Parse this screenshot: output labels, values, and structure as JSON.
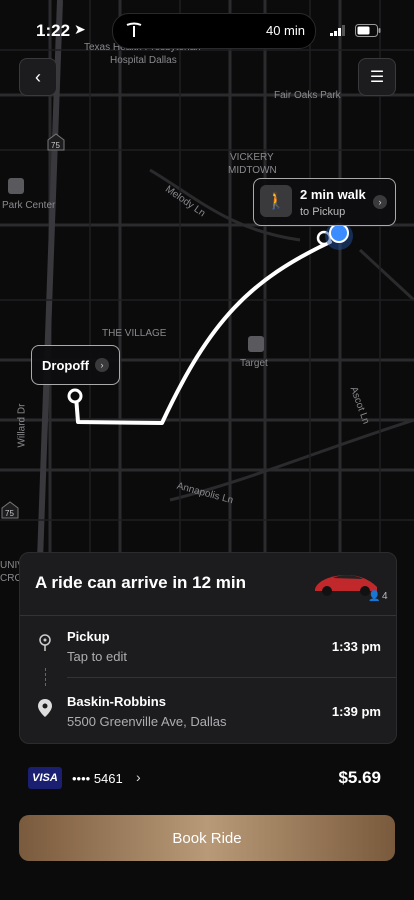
{
  "status_bar": {
    "time": "1:22",
    "eta": "40 min"
  },
  "map": {
    "labels": {
      "hospital_1": "Texas Health Presbyterian",
      "hospital_2": "Hospital Dallas",
      "fair_oaks": "Fair Oaks Park",
      "vickery_1": "VICKERY",
      "vickery_2": "MIDTOWN",
      "park_center": "Park Center",
      "melody": "Melody Ln",
      "village": "THE VILLAGE",
      "target": "Target",
      "willard": "Willard Dr",
      "ascot": "Ascot Ln",
      "annapolis": "Annapolis Ln",
      "hwy_75_top": "75",
      "hwy_75_bottom": "75",
      "univ": "UNIV",
      "cro": "CRO"
    }
  },
  "callouts": {
    "walk_title": "2 min walk",
    "walk_sub": "to Pickup",
    "dropoff": "Dropoff"
  },
  "card": {
    "title": "A ride can arrive in 12 min",
    "seats": "4",
    "pickup_label": "Pickup",
    "pickup_sub": "Tap to edit",
    "pickup_time": "1:33 pm",
    "dest_label": "Baskin-Robbins",
    "dest_sub": "5500 Greenville Ave, Dallas",
    "dest_time": "1:39 pm"
  },
  "payment": {
    "brand": "VISA",
    "card_masked": "•••• 5461",
    "price": "$5.69"
  },
  "book_button": "Book Ride",
  "colors": {
    "route": "#ffffff",
    "user_dot": "#3a8cff",
    "accent_gold": "#b89a78"
  }
}
